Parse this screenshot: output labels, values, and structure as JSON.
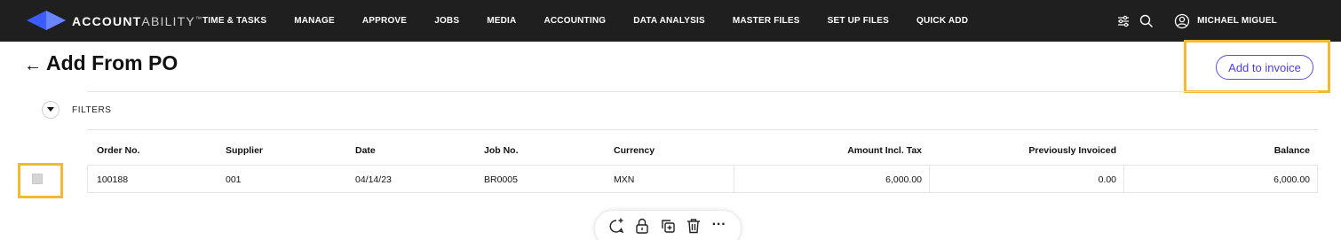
{
  "brand": {
    "bold": "ACCOUNT",
    "thin": "ABILITY",
    "tm": "™"
  },
  "nav": {
    "items": [
      {
        "label": "TIME & TASKS"
      },
      {
        "label": "MANAGE"
      },
      {
        "label": "APPROVE"
      },
      {
        "label": "JOBS"
      },
      {
        "label": "MEDIA"
      },
      {
        "label": "ACCOUNTING"
      },
      {
        "label": "DATA ANALYSIS"
      },
      {
        "label": "MASTER FILES"
      },
      {
        "label": "SET UP FILES"
      },
      {
        "label": "QUICK ADD"
      }
    ]
  },
  "user": {
    "name": "MICHAEL MIGUEL"
  },
  "icons": {
    "logo": "logo-diamond-icon",
    "filter_settings": "sliders-icon",
    "search": "search-icon",
    "user": "user-circle-icon",
    "back": "arrow-left-icon",
    "chevron": "chevron-down-icon",
    "toolbar": [
      "add-comment-icon",
      "lock-icon",
      "duplicate-icon",
      "trash-icon",
      "more-icon"
    ]
  },
  "colors": {
    "brand_blue": "#3b5cff",
    "accent": "#4b3fd6",
    "highlight": "#f5b82e",
    "topbar": "#1f1f1f"
  },
  "page": {
    "back": "←",
    "title": "Add From PO"
  },
  "actions": {
    "add_to_invoice": "Add to invoice"
  },
  "filters": {
    "label": "FILTERS"
  },
  "table": {
    "columns": [
      "Order No.",
      "Supplier",
      "Date",
      "Job No.",
      "Currency",
      "Amount Incl. Tax",
      "Previously Invoiced",
      "Balance"
    ],
    "rows": [
      {
        "order_no": "100188",
        "supplier": "001",
        "date": "04/14/23",
        "job_no": "BR0005",
        "currency": "MXN",
        "amount_incl_tax": "6,000.00",
        "previously_invoiced": "0.00",
        "balance": "6,000.00"
      }
    ]
  },
  "toolbar": {
    "more": "···"
  }
}
